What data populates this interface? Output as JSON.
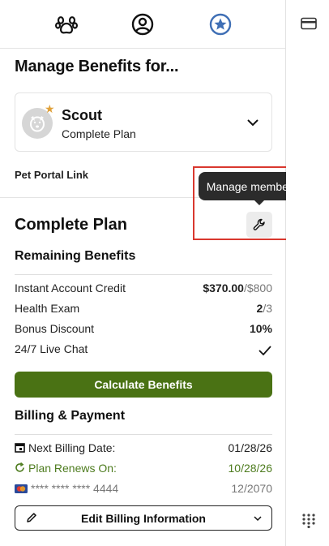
{
  "nav": {
    "tabs": [
      {
        "icon": "paw-icon"
      },
      {
        "icon": "user-circle-icon"
      },
      {
        "icon": "star-badge-icon",
        "active": true
      }
    ],
    "active_color": "#3f6fb5"
  },
  "header": {
    "title": "Manage Benefits for..."
  },
  "pet": {
    "name": "Scout",
    "plan": "Complete Plan"
  },
  "portal": {
    "label": "Pet Portal Link"
  },
  "tooltip": {
    "text": "Manage membership"
  },
  "plan": {
    "title": "Complete Plan"
  },
  "benefits": {
    "title": "Remaining Benefits",
    "rows": [
      {
        "label": "Instant Account Credit",
        "value": "$370.00",
        "value_total": "/$800"
      },
      {
        "label": "Health Exam",
        "value": "2",
        "value_total": "/3"
      },
      {
        "label": "Bonus Discount",
        "value": "10%"
      },
      {
        "label": "24/7 Live Chat",
        "value_icon": "checkmark-icon"
      }
    ]
  },
  "calculate_button": {
    "label": "Calculate Benefits"
  },
  "billing": {
    "title": "Billing & Payment",
    "next_billing_label": "Next Billing Date:",
    "next_billing_value": "01/28/26",
    "renews_label": "Plan Renews On:",
    "renews_value": "10/28/26",
    "card_number": "**** **** **** 4444",
    "card_expiry": "12/2070",
    "edit_label": "Edit Billing Information"
  },
  "colors": {
    "accent_green": "#4a7214",
    "renew_green": "#4e7c1f",
    "annotation_red": "#d9382f"
  }
}
